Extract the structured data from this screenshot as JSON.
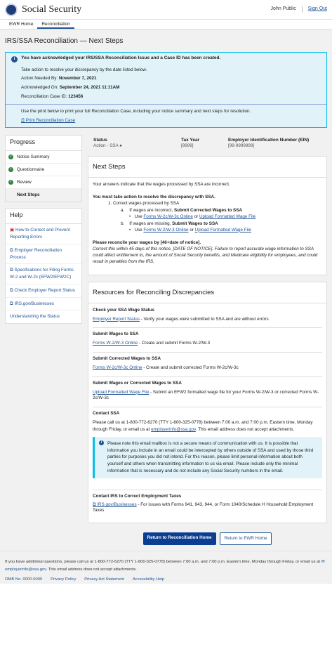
{
  "header": {
    "brand": "Social Security",
    "user": "John Public",
    "signout": "Sign Out"
  },
  "nav": {
    "tabs": [
      "EWR Home",
      "Reconciliation"
    ]
  },
  "page_title": "IRS/SSA Reconciliation — Next Steps",
  "alert": {
    "title": "You have acknowledged your IRS/SSA Reconciliation Issue and a Case ID has been created.",
    "intro": "Take action to resolve your discrepancy by the date listed below.",
    "action_label": "Action Needed By:",
    "action_value": "November 7, 2021",
    "ack_label": "Acknowledged On:",
    "ack_value": "September 24, 2021 11:11AM",
    "case_label": "Reconciliation Case ID:",
    "case_value": "123456",
    "print_text": "Use the print below to print your full Reconciliation Case, including your notice summary and next steps for resolution.",
    "print_link": "Print Reconciliation Case"
  },
  "progress": {
    "title": "Progress",
    "items": [
      "Notice Summary",
      "Questionnaire",
      "Review"
    ],
    "current": "Next Steps"
  },
  "help": {
    "title": "Help",
    "links": [
      "How to Correct and Prevent Reporting Errors",
      "Employer Reconciliation Process",
      "Specifications for Filing Forms W-2 and W-2c (EFW2/EFW2C)",
      "Check Employer Report Status",
      "IRS.gov/Businesses",
      "Understanding the Status"
    ]
  },
  "status": {
    "status_label": "Status",
    "status_value": "Action - SSA",
    "tax_year_label": "Tax Year",
    "tax_year_value": "[9999]",
    "ein_label": "Employer Identification Number (EIN)",
    "ein_value": "[99-9999999]"
  },
  "next_steps": {
    "title": "Next Steps",
    "intro": "Your answers indicate that the wages processed by SSA are incorrect.",
    "must": "You must take action to resolve the discrepancy with SSA.",
    "step1": "1. Correct wages processed by SSA",
    "a_prefix": "a.",
    "a_text": "If wages are incorrect,",
    "a_bold": "Submit Corrected Wages to SSA",
    "a_bullet_prefix": "Use",
    "a_link1": "Forms W-2c/W-3c Online",
    "a_or": "or",
    "a_link2": "Upload Formatted Wage File",
    "b_prefix": "b.",
    "b_text": "If wages are missing,",
    "b_bold": "Submit Wages to SSA",
    "b_link1": "Forms W-2/W-3 Online",
    "b_link2": "Upload Formatted Wage File",
    "reconcile_bold": "Please reconcile your wages by [46+date of notice].",
    "reconcile_italic": "Correct this within 45 days of this notice, [DATE OF NOTICE]. Failure to report accurate wage information to SSA could affect entitlement to, the amount of Social Security benefits, and Medicare eligibility for employees, and could result in penalties from the IRS."
  },
  "resources": {
    "title": "Resources for Reconciling Discrepancies",
    "items": [
      {
        "heading": "Check your SSA Wage Status",
        "link": "Employer Report Status",
        "text": " - Verify your wages were submitted to SSA and are without errors"
      },
      {
        "heading": "Submit Wages to SSA",
        "link": "Forms W-2/W-3 Online",
        "text": " - Create and submit Forms W-2/W-3"
      },
      {
        "heading": "Submit Corrected Wages to SSA",
        "link": "Forms W-2c/W-3c Online",
        "text": " - Create and submit corrected Forms W-2c/W-3c"
      },
      {
        "heading": "Submit Wages or Corrected Wages to SSA",
        "link": "Upload Formatted Wage File",
        "text": " - Submit an EFW2 formatted wage file for your Forms W-2/W-3 or corrected Forms W-2c/W-3c"
      }
    ],
    "contact_heading": "Contact SSA",
    "contact_text1": "Please call us at 1-800-772-6270 (TTY 1-800-325-0778) between 7:00 a.m. and 7:00 p.m. Eastern time, Monday through Friday, or email us at",
    "contact_email": "employerinfo@ssa.gov",
    "contact_text2": ". This email address does not accept attachments.",
    "note": "Please note this email mailbox is not a secure means of communication with us. It is possible that information you include in an email could be intercepted by others outside of SSA and used by those third parties for purposes you did not intend. For this reason, please limit personal information about both yourself and others when transmitting information to us via email. Please include only the minimal information that is necessary and do not include any Social Security numbers in the email.",
    "irs_heading": "Contact IRS to Correct Employment Taxes",
    "irs_link": "IRS.gov/Businesses",
    "irs_text": " - For issues with Forms 941, 943, 944, or Form 1040/Schedule H Household Employment Taxes"
  },
  "buttons": {
    "primary": "Return to Reconciliation Home",
    "secondary": "Return to EWR Home"
  },
  "footer": {
    "text1": "If you have additional questions, please call us at 1-800-772-6270 (TTY 1-800-325-0778) between 7:00 a.m. and 7:00 p.m. Eastern time, Monday through Friday, or email us at",
    "email": "employerinfo@ssa.gov",
    "text2": ". This email address does not accept attachments.",
    "links": [
      "OMB No. 0000-0000",
      "Privacy Policy",
      "Privacy Act Statement",
      "Accessibility Help"
    ]
  },
  "colors": {
    "primary": "#0b3d91",
    "link": "#205493",
    "alert_bg": "#e1f3f8",
    "alert_border": "#02bfe7",
    "success": "#2e8540"
  }
}
